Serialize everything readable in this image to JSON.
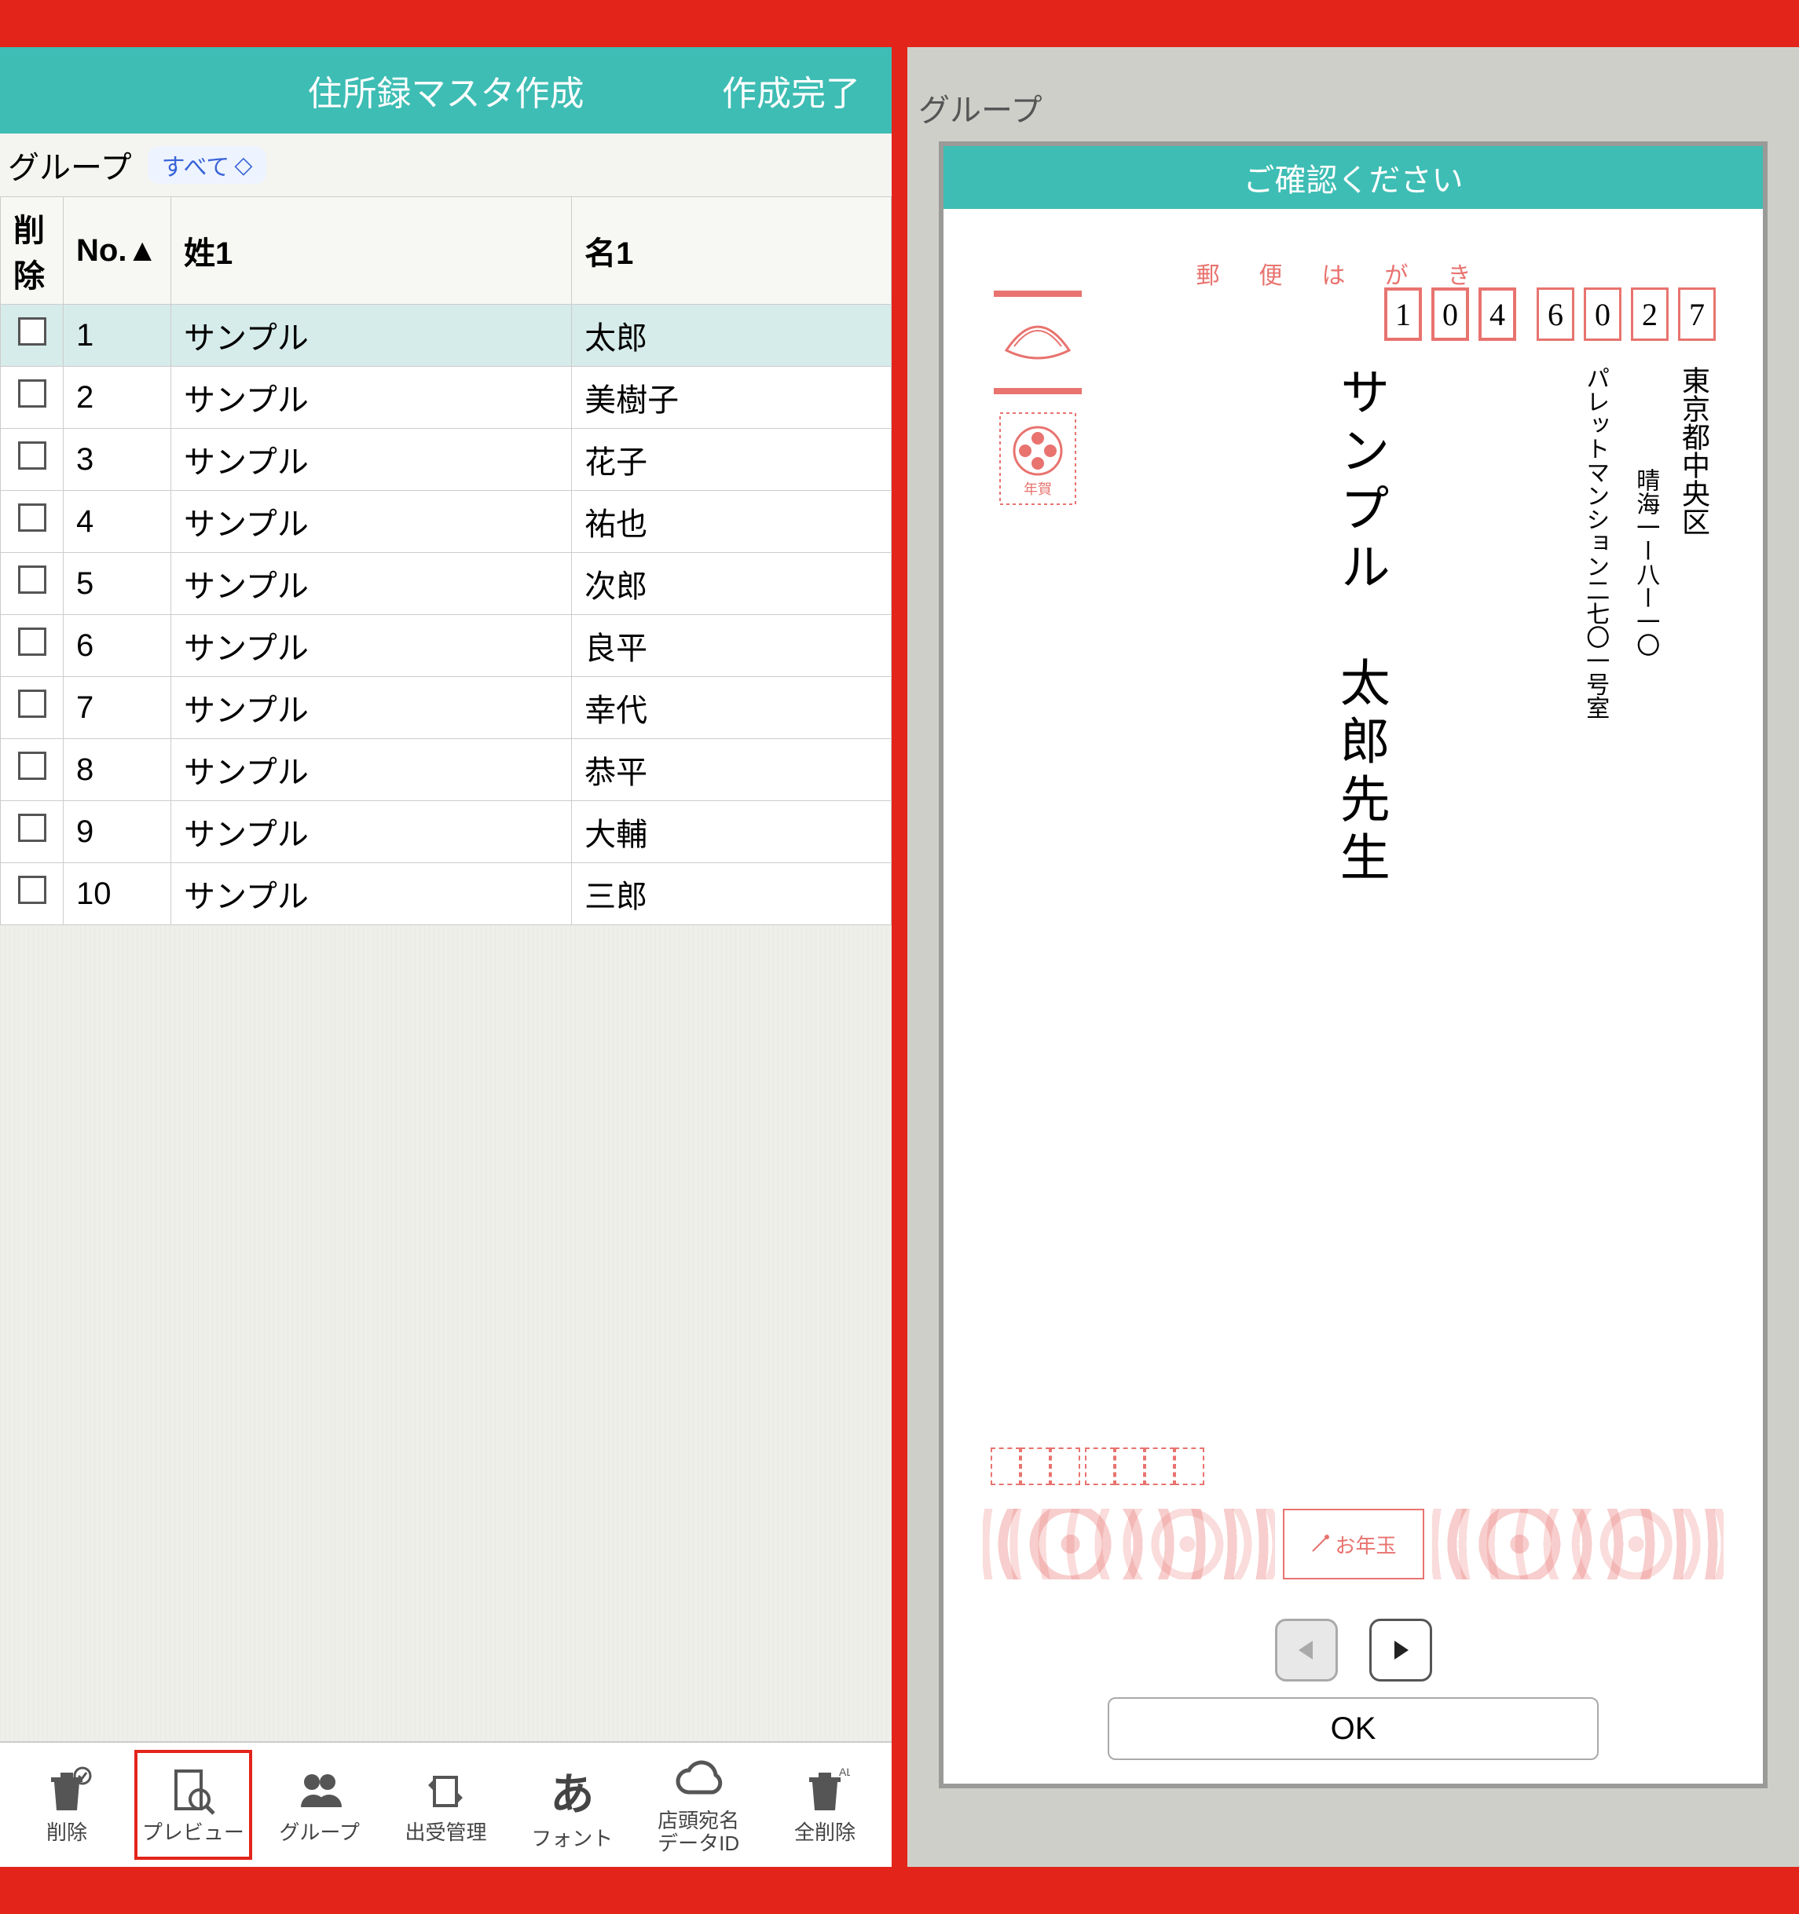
{
  "left": {
    "header": {
      "title": "住所録マスタ作成",
      "done": "作成完了"
    },
    "group": {
      "label": "グループ",
      "selected": "すべて"
    },
    "columns": {
      "del": "削除",
      "no": "No.▲",
      "sei": "姓1",
      "mei": "名1"
    },
    "rows": [
      {
        "no": "1",
        "sei": "サンプル",
        "mei": "太郎",
        "selected": true
      },
      {
        "no": "2",
        "sei": "サンプル",
        "mei": "美樹子",
        "selected": false
      },
      {
        "no": "3",
        "sei": "サンプル",
        "mei": "花子",
        "selected": false
      },
      {
        "no": "4",
        "sei": "サンプル",
        "mei": "祐也",
        "selected": false
      },
      {
        "no": "5",
        "sei": "サンプル",
        "mei": "次郎",
        "selected": false
      },
      {
        "no": "6",
        "sei": "サンプル",
        "mei": "良平",
        "selected": false
      },
      {
        "no": "7",
        "sei": "サンプル",
        "mei": "幸代",
        "selected": false
      },
      {
        "no": "8",
        "sei": "サンプル",
        "mei": "恭平",
        "selected": false
      },
      {
        "no": "9",
        "sei": "サンプル",
        "mei": "大輔",
        "selected": false
      },
      {
        "no": "10",
        "sei": "サンプル",
        "mei": "三郎",
        "selected": false
      }
    ],
    "toolbar": {
      "delete": "削除",
      "preview": "プレビュー",
      "group": "グループ",
      "manage": "出受管理",
      "font": "フォント",
      "font_icon": "あ",
      "dataid": "店頭宛名\nデータID",
      "delete_all": "全削除",
      "all_badge": "ALL"
    }
  },
  "right": {
    "bg_group": "グループ",
    "dlg_title": "ご確認ください",
    "yubin_label": "郵便はがき",
    "zip": [
      "1",
      "0",
      "4",
      "6",
      "0",
      "2",
      "7"
    ],
    "address1": "東京都中央区",
    "address2": "晴海一ー八ー一〇",
    "address3": "パレットマンション二七〇一号室",
    "name": "サンプル　太郎先生",
    "otoshidama": "お年玉",
    "ok": "OK"
  }
}
